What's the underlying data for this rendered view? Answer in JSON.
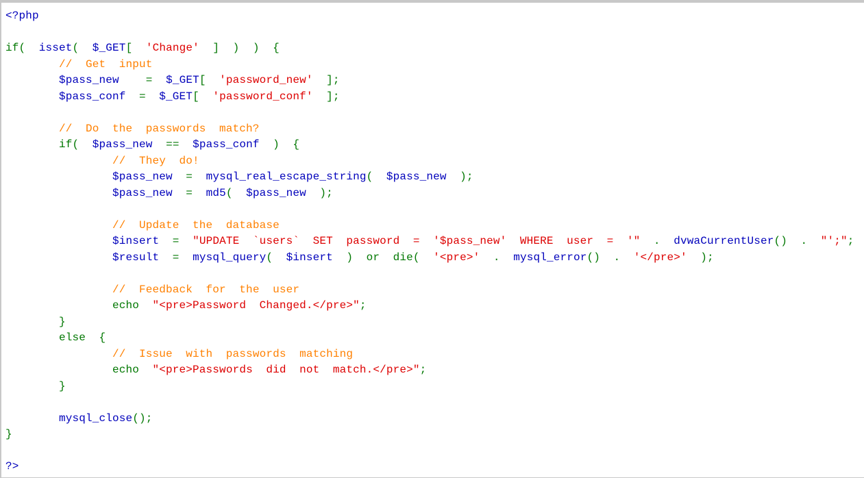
{
  "colors": {
    "default": "#0000BB",
    "keyword": "#007700",
    "string": "#DD0000",
    "comment": "#FF8000"
  },
  "code_lines": [
    [
      [
        "d",
        "<?php"
      ]
    ],
    [],
    [
      [
        "k",
        "if(  "
      ],
      [
        "d",
        "isset"
      ],
      [
        "k",
        "(  "
      ],
      [
        "d",
        "$_GET"
      ],
      [
        "k",
        "[  "
      ],
      [
        "s",
        "'Change'"
      ],
      [
        "k",
        "  ]  )  )  {"
      ]
    ],
    [
      [
        "d",
        "        "
      ],
      [
        "c",
        "//  Get  input"
      ]
    ],
    [
      [
        "d",
        "        $pass_new    "
      ],
      [
        "k",
        "=  "
      ],
      [
        "d",
        "$_GET"
      ],
      [
        "k",
        "[  "
      ],
      [
        "s",
        "'password_new'"
      ],
      [
        "k",
        "  ];"
      ]
    ],
    [
      [
        "d",
        "        $pass_conf  "
      ],
      [
        "k",
        "=  "
      ],
      [
        "d",
        "$_GET"
      ],
      [
        "k",
        "[  "
      ],
      [
        "s",
        "'password_conf'"
      ],
      [
        "k",
        "  ];"
      ]
    ],
    [],
    [
      [
        "d",
        "        "
      ],
      [
        "c",
        "//  Do  the  passwords  match?"
      ]
    ],
    [
      [
        "k",
        "        if(  "
      ],
      [
        "d",
        "$pass_new  "
      ],
      [
        "k",
        "==  "
      ],
      [
        "d",
        "$pass_conf  "
      ],
      [
        "k",
        ")  {"
      ]
    ],
    [
      [
        "d",
        "                "
      ],
      [
        "c",
        "//  They  do!"
      ]
    ],
    [
      [
        "d",
        "                $pass_new  "
      ],
      [
        "k",
        "=  "
      ],
      [
        "d",
        "mysql_real_escape_string"
      ],
      [
        "k",
        "(  "
      ],
      [
        "d",
        "$pass_new  "
      ],
      [
        "k",
        ");"
      ]
    ],
    [
      [
        "d",
        "                $pass_new  "
      ],
      [
        "k",
        "=  "
      ],
      [
        "d",
        "md5"
      ],
      [
        "k",
        "(  "
      ],
      [
        "d",
        "$pass_new  "
      ],
      [
        "k",
        ");"
      ]
    ],
    [],
    [
      [
        "d",
        "                "
      ],
      [
        "c",
        "//  Update  the  database"
      ]
    ],
    [
      [
        "d",
        "                $insert  "
      ],
      [
        "k",
        "=  "
      ],
      [
        "s",
        "\"UPDATE  `users`  SET  password  =  '$pass_new'  WHERE  user  =  '\"  "
      ],
      [
        "k",
        ".  "
      ],
      [
        "d",
        "dvwaCurrentUser"
      ],
      [
        "k",
        "()  .  "
      ],
      [
        "s",
        "\"';\""
      ],
      [
        "k",
        ";"
      ]
    ],
    [
      [
        "d",
        "                $result  "
      ],
      [
        "k",
        "=  "
      ],
      [
        "d",
        "mysql_query"
      ],
      [
        "k",
        "(  "
      ],
      [
        "d",
        "$insert  "
      ],
      [
        "k",
        ")  or  die(  "
      ],
      [
        "s",
        "'<pre>'  "
      ],
      [
        "k",
        ".  "
      ],
      [
        "d",
        "mysql_error"
      ],
      [
        "k",
        "()  .  "
      ],
      [
        "s",
        "'</pre>'  "
      ],
      [
        "k",
        ");"
      ]
    ],
    [],
    [
      [
        "d",
        "                "
      ],
      [
        "c",
        "//  Feedback  for  the  user"
      ]
    ],
    [
      [
        "k",
        "                echo  "
      ],
      [
        "s",
        "\"<pre>Password  Changed.</pre>\""
      ],
      [
        "k",
        ";"
      ]
    ],
    [
      [
        "k",
        "        }"
      ]
    ],
    [
      [
        "k",
        "        else  {"
      ]
    ],
    [
      [
        "d",
        "                "
      ],
      [
        "c",
        "//  Issue  with  passwords  matching"
      ]
    ],
    [
      [
        "k",
        "                echo  "
      ],
      [
        "s",
        "\"<pre>Passwords  did  not  match.</pre>\""
      ],
      [
        "k",
        ";"
      ]
    ],
    [
      [
        "k",
        "        }"
      ]
    ],
    [],
    [
      [
        "d",
        "        mysql_close"
      ],
      [
        "k",
        "();"
      ]
    ],
    [
      [
        "k",
        "}"
      ]
    ],
    [],
    [
      [
        "d",
        "?>"
      ]
    ]
  ]
}
